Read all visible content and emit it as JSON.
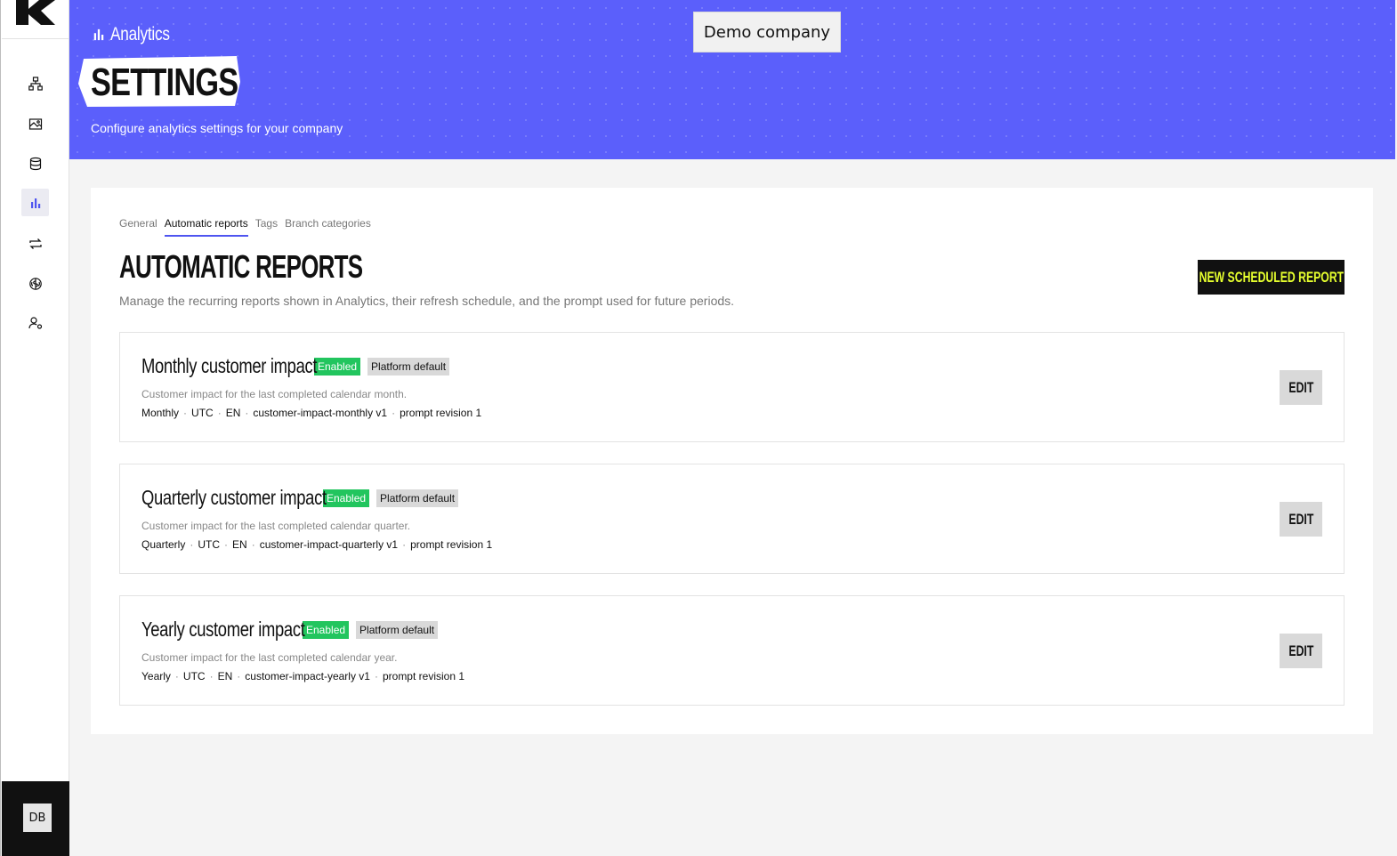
{
  "sidebar": {
    "items": [
      {
        "icon": "hierarchy-icon"
      },
      {
        "icon": "assets-icon"
      },
      {
        "icon": "database-icon"
      },
      {
        "icon": "analytics-icon",
        "active": true
      },
      {
        "icon": "sync-icon"
      },
      {
        "icon": "brain-icon"
      },
      {
        "icon": "user-settings-icon"
      }
    ],
    "user_initials": "DB"
  },
  "header": {
    "breadcrumb": "Analytics",
    "title": "SETTINGS",
    "subtitle": "Configure analytics settings for your company",
    "company": "Demo company",
    "accent_color": "#5b5ffb"
  },
  "tabs": [
    {
      "label": "General",
      "active": false
    },
    {
      "label": "Automatic reports",
      "active": true
    },
    {
      "label": "Tags",
      "active": false
    },
    {
      "label": "Branch categories",
      "active": false
    }
  ],
  "section": {
    "title": "AUTOMATIC REPORTS",
    "description": "Manage the recurring reports shown in Analytics, their refresh schedule, and the prompt used for future periods.",
    "new_button": "NEW SCHEDULED REPORT"
  },
  "reports": [
    {
      "name": "Monthly customer impact",
      "status": "Enabled",
      "source": "Platform default",
      "description": "Customer impact for the last completed calendar month.",
      "meta": [
        "Monthly",
        "UTC",
        "EN",
        "customer-impact-monthly v1",
        "prompt revision 1"
      ],
      "edit": "EDIT"
    },
    {
      "name": "Quarterly customer impact",
      "status": "Enabled",
      "source": "Platform default",
      "description": "Customer impact for the last completed calendar quarter.",
      "meta": [
        "Quarterly",
        "UTC",
        "EN",
        "customer-impact-quarterly v1",
        "prompt revision 1"
      ],
      "edit": "EDIT"
    },
    {
      "name": "Yearly customer impact",
      "status": "Enabled",
      "source": "Platform default",
      "description": "Customer impact for the last completed calendar year.",
      "meta": [
        "Yearly",
        "UTC",
        "EN",
        "customer-impact-yearly v1",
        "prompt revision 1"
      ],
      "edit": "EDIT"
    }
  ]
}
